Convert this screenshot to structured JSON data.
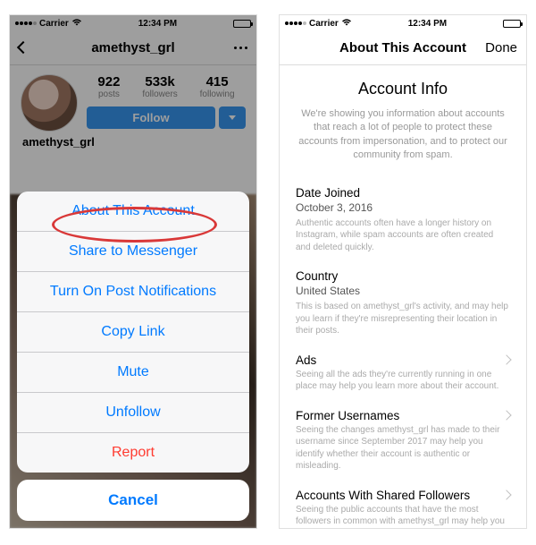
{
  "status": {
    "carrier": "Carrier",
    "time": "12:34 PM"
  },
  "left": {
    "nav_title": "amethyst_grl",
    "stats": {
      "posts_n": "922",
      "posts_l": "posts",
      "followers_n": "533k",
      "followers_l": "followers",
      "following_n": "415",
      "following_l": "following"
    },
    "follow_label": "Follow",
    "username": "amethyst_grl",
    "sheet": {
      "about": "About This Account",
      "share": "Share to Messenger",
      "notify": "Turn On Post Notifications",
      "copy": "Copy Link",
      "mute": "Mute",
      "unfollow": "Unfollow",
      "report": "Report",
      "cancel": "Cancel"
    }
  },
  "right": {
    "nav_title": "About This Account",
    "done": "Done",
    "info_title": "Account Info",
    "info_desc": "We're showing you information about accounts that reach a lot of people to protect these accounts from impersonation, and to protect our community from spam.",
    "date_joined": {
      "h": "Date Joined",
      "v": "October 3, 2016",
      "d": "Authentic accounts often have a longer history on Instagram, while spam accounts are often created and deleted quickly."
    },
    "country": {
      "h": "Country",
      "v": "United States",
      "d": "This is based on amethyst_grl's activity, and may help you learn if they're misrepresenting their location in their posts."
    },
    "ads": {
      "h": "Ads",
      "d": "Seeing all the ads they're currently running in one place may help you learn more about their account."
    },
    "usernames": {
      "h": "Former Usernames",
      "d": "Seeing the changes amethyst_grl has made to their username since September 2017 may help you identify whether their account is authentic or misleading."
    },
    "shared": {
      "h": "Accounts With Shared Followers",
      "d": "Seeing the public accounts that have the most followers in common with amethyst_grl may help you identify accounts with similar interests."
    }
  }
}
